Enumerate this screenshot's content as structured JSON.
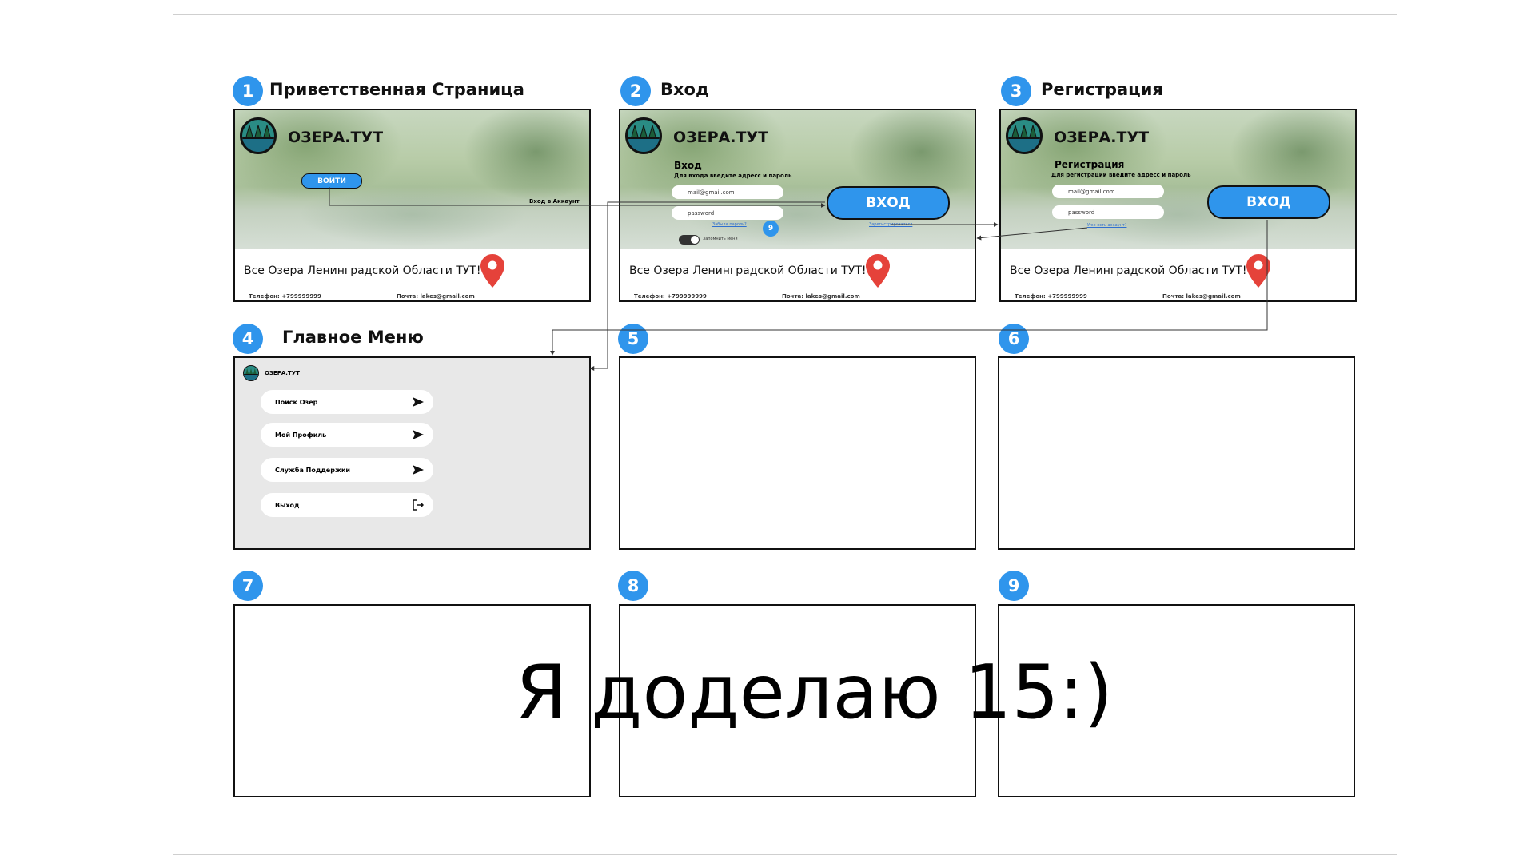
{
  "frames": [
    {
      "number": "1",
      "title": "Приветственная Страница"
    },
    {
      "number": "2",
      "title": "Вход"
    },
    {
      "number": "3",
      "title": "Регистрация"
    },
    {
      "number": "4",
      "title": "Главное Меню"
    },
    {
      "number": "5",
      "title": ""
    },
    {
      "number": "6",
      "title": ""
    },
    {
      "number": "7",
      "title": ""
    },
    {
      "number": "8",
      "title": ""
    },
    {
      "number": "9",
      "title": ""
    }
  ],
  "app": {
    "brand": "ОЗЕРА.ТУТ",
    "tagline": "Все Озера Ленинградской Области ТУТ!",
    "phone": "Телефон: +799999999",
    "email": "Почта: lakes@gmail.com"
  },
  "welcome": {
    "login_button": "ВОЙТИ",
    "connector_label": "Вход в Аккаунт"
  },
  "login": {
    "heading": "Вход",
    "subheading": "Для входа введите адресс и пароль",
    "email_value": "mail@gmail.com",
    "password_value": "password",
    "forgot_link": "Забыли пароль?",
    "remember_label": "Запомнить меня",
    "register_link": "Зарегистрироваться",
    "submit_button": "ВХОД",
    "note_badge": "9"
  },
  "register": {
    "heading": "Регистрация",
    "subheading": "Для регистрации введите адресс и пароль",
    "email_value": "mail@gmail.com",
    "password_value": "password",
    "have_account_link": "Уже есть аккаунт?",
    "submit_button": "ВХОД"
  },
  "menu": {
    "brand": "ОЗЕРА.ТУТ",
    "items": [
      {
        "label": "Поиск Озер",
        "icon": "send-arrow-icon"
      },
      {
        "label": "Мой Профиль",
        "icon": "send-arrow-icon"
      },
      {
        "label": "Служба Поддержки",
        "icon": "send-arrow-icon"
      },
      {
        "label": "Выход",
        "icon": "logout-icon"
      }
    ]
  },
  "overlay_text": "Я доделаю 15:)",
  "colors": {
    "accent": "#2f95ec",
    "pin": "#e5423a",
    "menu_bg": "#e8e8e8"
  }
}
